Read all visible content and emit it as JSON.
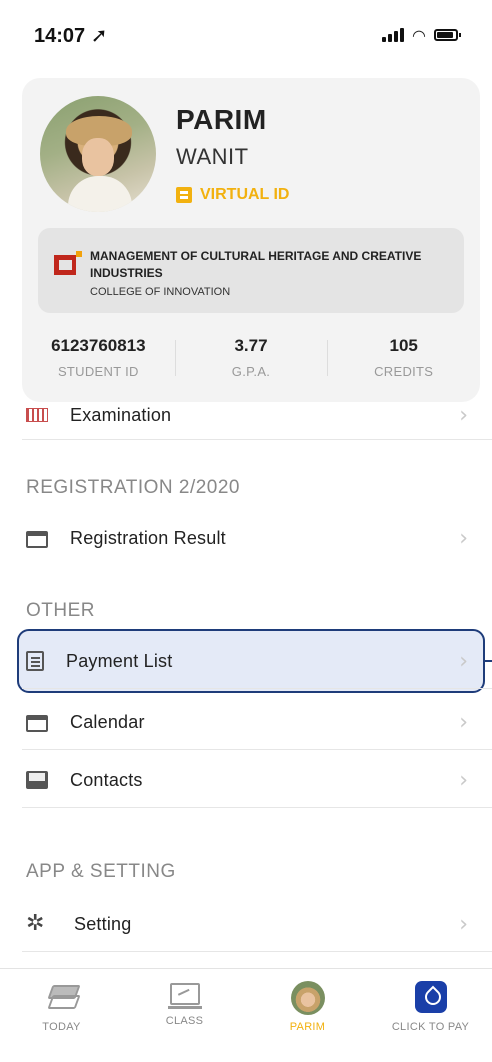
{
  "status_bar": {
    "time": "14:07"
  },
  "profile": {
    "first_name": "PARIM",
    "last_name": "WANIT",
    "virtual_id_label": "VIRTUAL ID",
    "department": "MANAGEMENT OF CULTURAL HERITAGE AND CREATIVE INDUSTRIES",
    "college": "COLLEGE OF INNOVATION",
    "stats": [
      {
        "value": "6123760813",
        "label": "STUDENT ID"
      },
      {
        "value": "3.77",
        "label": "G.P.A."
      },
      {
        "value": "105",
        "label": "CREDITS"
      }
    ]
  },
  "menu": {
    "examination": "Examination",
    "registration_section": "REGISTRATION 2/2020",
    "registration_result": "Registration Result",
    "other_section": "OTHER",
    "payment_list": "Payment List",
    "calendar": "Calendar",
    "contacts": "Contacts",
    "app_section": "APP & SETTING",
    "setting": "Setting",
    "chevron": "›"
  },
  "tabbar": {
    "items": [
      {
        "label": "TODAY",
        "icon": "layers-icon"
      },
      {
        "label": "CLASS",
        "icon": "laptop-chart-icon"
      },
      {
        "label": "PARIM",
        "icon": "avatar-icon",
        "active": true
      },
      {
        "label": "CLICK TO PAY",
        "icon": "pay-icon"
      }
    ]
  },
  "colors": {
    "accent": "#f2b10f",
    "highlight_border": "#1e3c7a",
    "pay_blue": "#1a3fa8"
  }
}
